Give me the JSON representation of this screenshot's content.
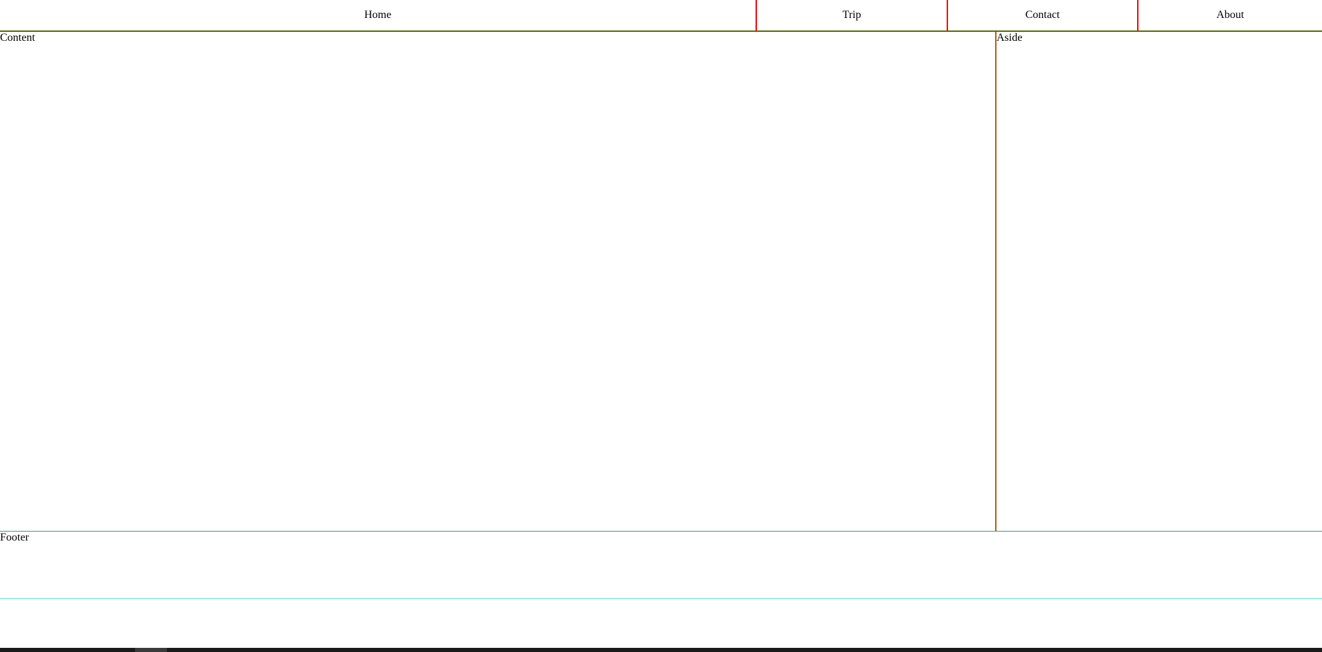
{
  "nav": {
    "items": [
      {
        "label": "Home"
      },
      {
        "label": "Trip"
      },
      {
        "label": "Contact"
      },
      {
        "label": "About"
      }
    ]
  },
  "content": {
    "label": "Content"
  },
  "aside": {
    "label": "Aside"
  },
  "footer": {
    "label": "Footer"
  },
  "colors": {
    "nav_border": "#556b00",
    "nav_divider": "#ff0000",
    "aside_border": "#b35a1f",
    "content_border": "#2aa07a",
    "footer_border": "#5ee6d8"
  }
}
